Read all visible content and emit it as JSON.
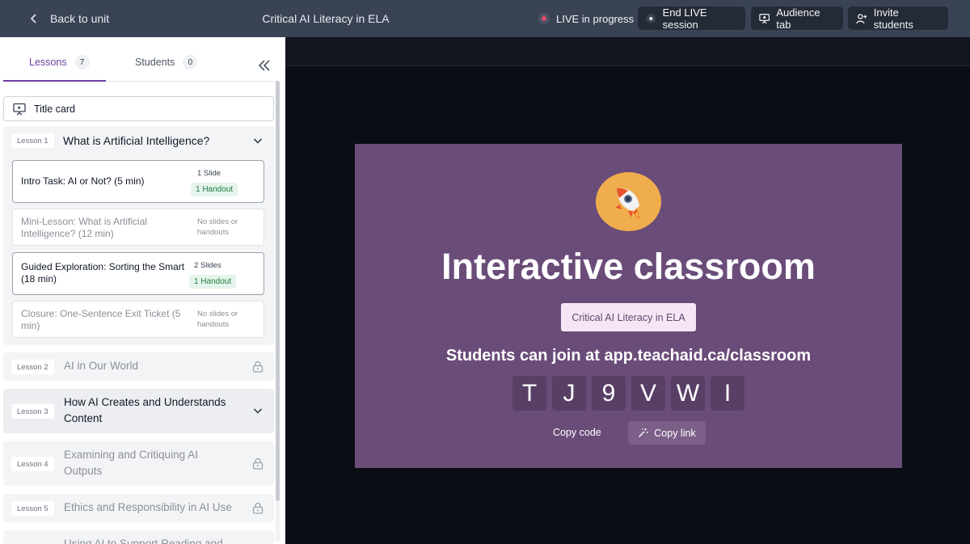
{
  "topbar": {
    "back_label": "Back to unit",
    "course_title": "Critical AI Literacy in ELA",
    "live_status": "LIVE in progress",
    "end_label": "End LIVE session",
    "audience_label": "Audience tab",
    "invite_label": "Invite students",
    "live_dot_color": "#e04b6a"
  },
  "sidebar": {
    "tabs": [
      {
        "label": "Lessons",
        "count": "7"
      },
      {
        "label": "Students",
        "count": "0"
      }
    ],
    "title_card": "Title card",
    "lessons": [
      {
        "tag": "Lesson 1",
        "name": "What is Artificial Intelligence?",
        "items": [
          {
            "title": "Intro Task: AI or Not? (5 min)",
            "slides": "1 Slide",
            "handouts": "1 Handout"
          },
          {
            "title": "Mini-Lesson: What is Artificial Intelligence? (12 min)",
            "meta": "No slides or handouts"
          },
          {
            "title": "Guided Exploration: Sorting the Smart (18 min)",
            "slides": "2 Slides",
            "handouts": "1 Handout"
          },
          {
            "title": "Closure: One-Sentence Exit Ticket (5 min)",
            "meta": "No slides or handouts"
          }
        ]
      },
      {
        "tag": "Lesson 2",
        "name": "AI in Our World"
      },
      {
        "tag": "Lesson 3",
        "name": "How AI Creates and Understands Content"
      },
      {
        "tag": "Lesson 4",
        "name": "Examining and Critiquing AI Outputs"
      },
      {
        "tag": "Lesson 5",
        "name": "Ethics and Responsibility in AI Use"
      },
      {
        "tag": "",
        "name": "Using AI to Support Reading and"
      }
    ]
  },
  "stage": {
    "heading": "Interactive classroom",
    "class_name": "Critical AI Literacy in ELA",
    "join_text": "Students can join at app.teachaid.ca/classroom",
    "code": [
      "T",
      "J",
      "9",
      "V",
      "W",
      "I"
    ],
    "copy_code_label": "Copy code",
    "copy_link_label": "Copy link",
    "background_color": "#6a4c79"
  }
}
